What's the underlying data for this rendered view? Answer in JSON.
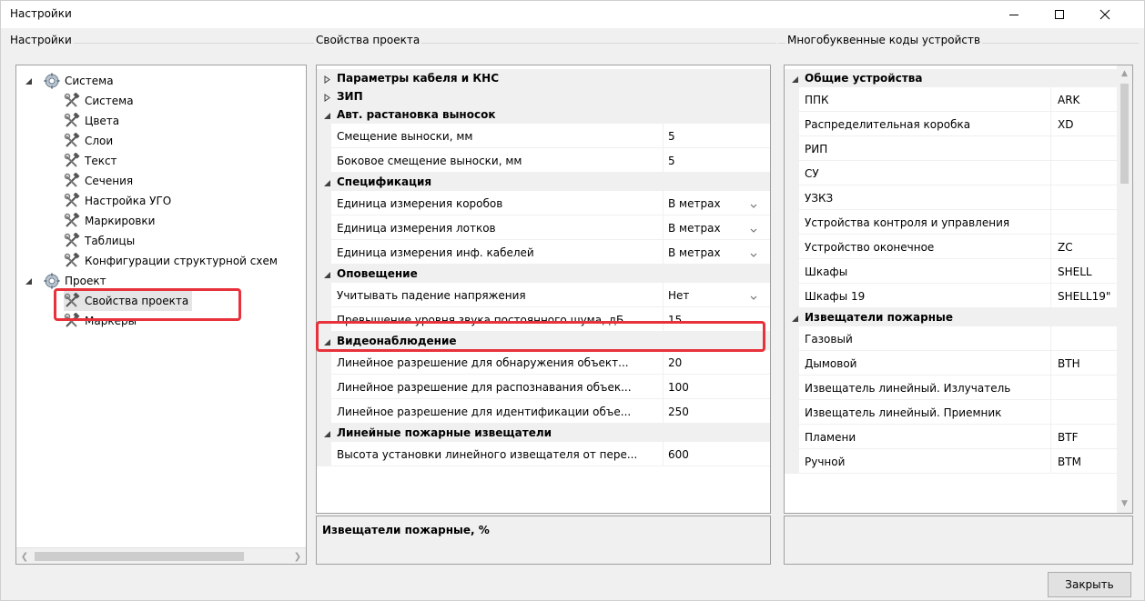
{
  "window": {
    "title": "Настройки",
    "controls": {
      "minimize_icon": "minimize-icon",
      "maximize_icon": "maximize-icon",
      "close_icon": "close-icon"
    }
  },
  "tree_panel": {
    "label": "Настройки",
    "nodes": [
      {
        "label": "Система",
        "icon": "gear-icon",
        "level": 0,
        "expanded": true
      },
      {
        "label": "Система",
        "icon": "tools-icon",
        "level": 1
      },
      {
        "label": "Цвета",
        "icon": "tools-icon",
        "level": 1
      },
      {
        "label": "Слои",
        "icon": "tools-icon",
        "level": 1
      },
      {
        "label": "Текст",
        "icon": "tools-icon",
        "level": 1
      },
      {
        "label": "Сечения",
        "icon": "tools-icon",
        "level": 1
      },
      {
        "label": "Настройка УГО",
        "icon": "tools-icon",
        "level": 1
      },
      {
        "label": "Маркировки",
        "icon": "tools-icon",
        "level": 1
      },
      {
        "label": "Таблицы",
        "icon": "tools-icon",
        "level": 1
      },
      {
        "label": "Конфигурации структурной схем",
        "icon": "tools-icon",
        "level": 1
      },
      {
        "label": "Проект",
        "icon": "gear-icon",
        "level": 0,
        "expanded": true
      },
      {
        "label": "Свойства проекта",
        "icon": "tools-icon",
        "level": 1,
        "selected": true
      },
      {
        "label": "Маркеры",
        "icon": "tools-icon",
        "level": 1
      }
    ]
  },
  "props_panel": {
    "label": "Свойства проекта",
    "rows": [
      {
        "type": "category",
        "label": "Параметры кабеля и КНС",
        "expanded": false
      },
      {
        "type": "category",
        "label": "ЗИП",
        "expanded": false
      },
      {
        "type": "category",
        "label": "Авт. растановка выносок",
        "expanded": true
      },
      {
        "type": "prop",
        "label": "Смещение выноски, мм",
        "value": "5"
      },
      {
        "type": "prop",
        "label": "Боковое смещение выноски, мм",
        "value": "5"
      },
      {
        "type": "category",
        "label": "Спецификация",
        "expanded": true
      },
      {
        "type": "prop",
        "label": "Единица измерения коробов",
        "value": "В метрах",
        "dropdown": true
      },
      {
        "type": "prop",
        "label": "Единица измерения лотков",
        "value": "В метрах",
        "dropdown": true
      },
      {
        "type": "prop",
        "label": "Единица измерения инф. кабелей",
        "value": "В метрах",
        "dropdown": true
      },
      {
        "type": "category",
        "label": "Оповещение",
        "expanded": true
      },
      {
        "type": "prop",
        "label": "Учитывать падение напряжения",
        "value": "Нет",
        "dropdown": true
      },
      {
        "type": "prop",
        "label": "Превышение уровня звука постоянного шума, дБ",
        "value": "15",
        "highlighted": true
      },
      {
        "type": "category",
        "label": "Видеонаблюдение",
        "expanded": true
      },
      {
        "type": "prop",
        "label": "Линейное разрешение для обнаружения объект...",
        "value": "20"
      },
      {
        "type": "prop",
        "label": "Линейное разрешение для распознавания объек...",
        "value": "100"
      },
      {
        "type": "prop",
        "label": "Линейное разрешение для идентификации объе...",
        "value": "250"
      },
      {
        "type": "category",
        "label": "Линейные пожарные извещатели",
        "expanded": true
      },
      {
        "type": "prop",
        "label": "Высота установки линейного извещателя от пере...",
        "value": "600"
      }
    ],
    "description": "Извещатели пожарные, %"
  },
  "codes_panel": {
    "label": "Многобуквенные коды устройств",
    "rows": [
      {
        "type": "category",
        "label": "Общие устройства",
        "expanded": true
      },
      {
        "type": "prop",
        "label": "ППК",
        "value": "ARK"
      },
      {
        "type": "prop",
        "label": "Распределительная коробка",
        "value": "XD"
      },
      {
        "type": "prop",
        "label": "РИП",
        "value": ""
      },
      {
        "type": "prop",
        "label": "СУ",
        "value": ""
      },
      {
        "type": "prop",
        "label": "УЗКЗ",
        "value": ""
      },
      {
        "type": "prop",
        "label": "Устройства контроля и управления",
        "value": ""
      },
      {
        "type": "prop",
        "label": "Устройство оконечное",
        "value": "ZC"
      },
      {
        "type": "prop",
        "label": "Шкафы",
        "value": "SHELL"
      },
      {
        "type": "prop",
        "label": "Шкафы 19",
        "value": "SHELL19\""
      },
      {
        "type": "category",
        "label": "Извещатели пожарные",
        "expanded": true
      },
      {
        "type": "prop",
        "label": "Газовый",
        "value": ""
      },
      {
        "type": "prop",
        "label": "Дымовой",
        "value": "BTH"
      },
      {
        "type": "prop",
        "label": "Извещатель линейный. Излучатель",
        "value": ""
      },
      {
        "type": "prop",
        "label": "Извещатель линейный. Приемник",
        "value": ""
      },
      {
        "type": "prop",
        "label": "Пламени",
        "value": "BTF"
      },
      {
        "type": "prop",
        "label": "Ручной",
        "value": "BTM"
      }
    ]
  },
  "footer": {
    "close_label": "Закрыть"
  },
  "colors": {
    "highlight": "#e8323b",
    "selection": "#e5e5e5",
    "border": "#a0a0a0"
  }
}
